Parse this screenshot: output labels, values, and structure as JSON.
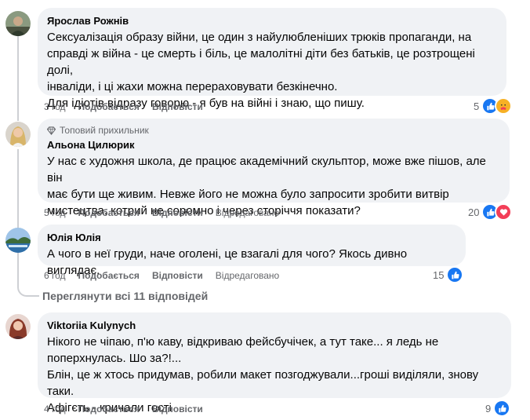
{
  "comments": [
    {
      "author": "Ярослав Рожнів",
      "lines": [
        "Сексуалізація образу війни, це один з найулюбленіших трюків пропаганди, на",
        "справді ж війна - це смерть і біль, це малолітні діти без батьків, це розтрощені долі,",
        "інваліди, і ці жахи можна перераховувати безкінечно.",
        "Для ідіотів відразу говорю - я був на війні і знаю, що пишу."
      ],
      "time": "3 год",
      "like_label": "Подобається",
      "reply_label": "Відповісти",
      "reaction_count": "5",
      "reactions": [
        "like-icon",
        "care-icon"
      ]
    },
    {
      "badge": "Топовий прихильник",
      "author": "Альона Цилюрик",
      "lines": [
        "У нас є художня школа, де працює академічний скульптор, може вже пішов, але він",
        "має бути ще живим. Невже його не можна було запросити зробити витвір",
        "мистецтва, котрий не соромно і через сторіччя показати?"
      ],
      "time": "5 год",
      "like_label": "Подобається",
      "reply_label": "Відповісти",
      "edited_label": "Відредаговано",
      "reaction_count": "20",
      "reactions": [
        "like-icon",
        "love-icon"
      ]
    },
    {
      "author": "Юлія Юлія",
      "lines": [
        "А чого в неї груди, наче оголені, це взагалі для чого? Якось дивно виглядає."
      ],
      "time": "6 год",
      "like_label": "Подобається",
      "reply_label": "Відповісти",
      "edited_label": "Відредаговано",
      "reaction_count": "15",
      "reactions": [
        "like-icon"
      ]
    },
    {
      "author": "Viktoriia Kulynych",
      "lines": [
        "Нікого не чіпаю, п'ю каву, відкриваю фейсбучічек, а тут таке... я ледь не",
        "поперхнулась. Шо за?!...",
        "Блін, це ж хтось придумав, робили макет позгоджували...гроші виділяли, знову таки.",
        "Афігєть - кричали гості"
      ],
      "time": "4 год",
      "like_label": "Подобається",
      "reply_label": "Відповісти",
      "reaction_count": "9",
      "reactions": [
        "like-icon"
      ]
    }
  ],
  "view_replies_label": "Переглянути всі 11 відповідей",
  "colors": {
    "bubble": "#f0f2f5",
    "secondary_text": "#65676b",
    "like": "#1877f2",
    "love": "#f33e58"
  }
}
